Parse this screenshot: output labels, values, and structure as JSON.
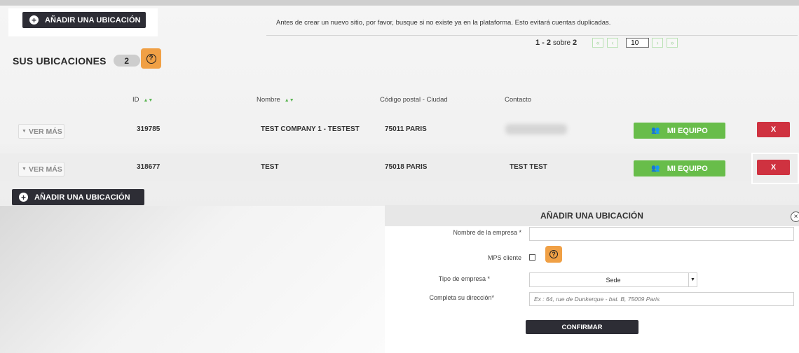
{
  "actions": {
    "add_location_label": "AÑADIR UNA UBICACIÓN",
    "add_location_bottom_label": "AÑADIR UNA UBICACIÓN"
  },
  "notice": "Antes de crear un nuevo sitio, por favor, busque si no existe ya en la plataforma. Esto evitará cuentas duplicadas.",
  "pagination": {
    "range": "1 - 2",
    "sobre": "sobre",
    "total": "2",
    "per_page": "10",
    "first": "«",
    "prev": "‹",
    "next": "›",
    "last": "»"
  },
  "locations": {
    "title": "SUS UBICACIONES",
    "count": "2",
    "help": "?"
  },
  "table": {
    "headers": {
      "id": "ID",
      "name": "Nombre",
      "postal_city": "Código postal - Ciudad",
      "contact": "Contacto"
    },
    "sort_glyph": "▲▼",
    "rows": [
      {
        "ver_mas": "VER MÁS",
        "id": "319785",
        "name": "TEST COMPANY 1 - TESTEST",
        "postal_city": "75011 PARIS",
        "contact": "",
        "team_label": "MI EQUIPO",
        "delete_label": "X"
      },
      {
        "ver_mas": "VER MÁS",
        "id": "318677",
        "name": "TEST",
        "postal_city": "75018 PARIS",
        "contact": "TEST TEST",
        "team_label": "MI EQUIPO",
        "delete_label": "X"
      }
    ]
  },
  "modal": {
    "title": "AÑADIR UNA UBICACIÓN",
    "close": "×",
    "company_name_label": "Nombre de la empresa *",
    "company_name_value": "",
    "mps_label": "MPS cliente",
    "mps_help": "?",
    "company_type_label": "Tipo de empresa *",
    "company_type_value": "Sede",
    "address_label": "Completa su dirección*",
    "address_placeholder": "Ex : 64, rue de Dunkerque - bat. B, 75009 Paris",
    "confirm_label": "CONFIRMAR"
  },
  "icons": {
    "plus": "plus-circle-icon",
    "help": "question-circle-icon",
    "team": "people-icon",
    "caret": "caret-down-icon",
    "close": "close-icon"
  },
  "colors": {
    "dark_button": "#2d2d35",
    "help_orange": "#f0a045",
    "team_green": "#68bd4a",
    "delete_red": "#cf3240",
    "sort_green": "#5bb552"
  }
}
